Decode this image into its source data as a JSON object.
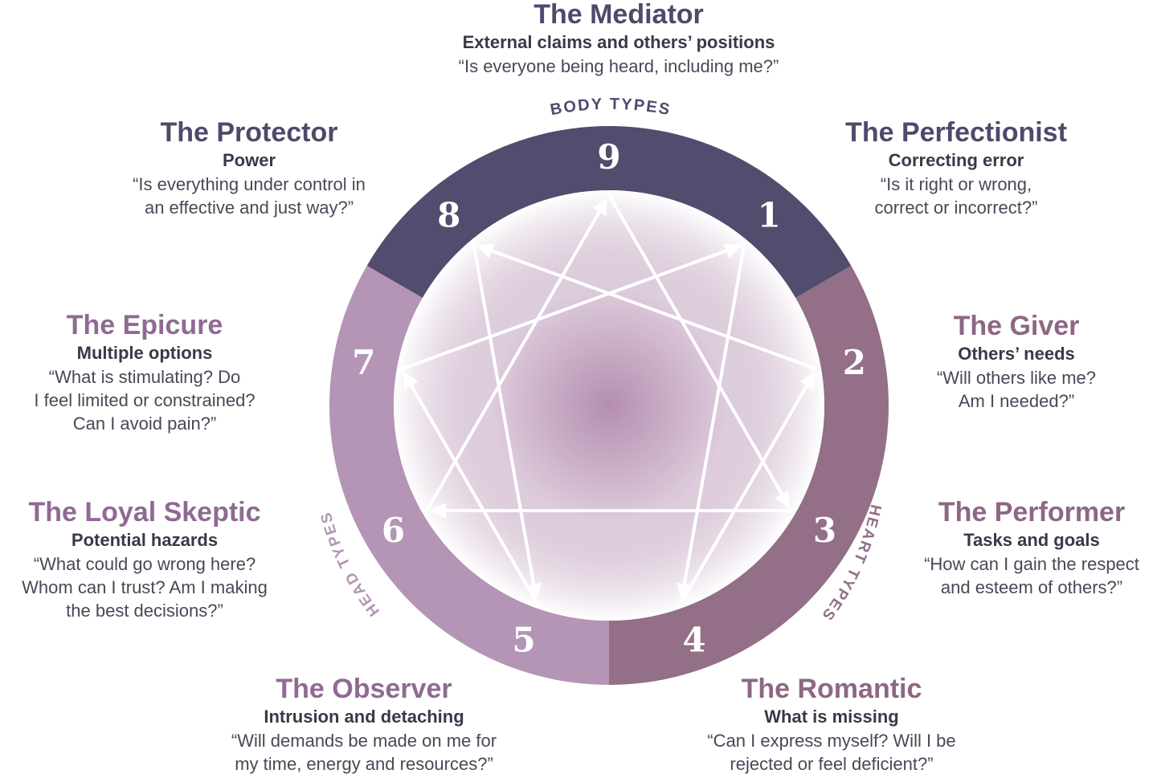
{
  "colors": {
    "body_ring": "#524d6e",
    "heart_ring": "#936f88",
    "head_ring": "#b495b5",
    "center_glow": "#b48eb0",
    "lines": "#ffffff"
  },
  "center": {
    "label": ""
  },
  "groups": {
    "body": "BODY TYPES",
    "heart": "HEART TYPES",
    "head": "HEAD TYPES"
  },
  "points": [
    {
      "number": "9"
    },
    {
      "number": "1"
    },
    {
      "number": "2"
    },
    {
      "number": "3"
    },
    {
      "number": "4"
    },
    {
      "number": "5"
    },
    {
      "number": "6"
    },
    {
      "number": "7"
    },
    {
      "number": "8"
    }
  ],
  "connections": {
    "triangle": [
      "9",
      "3",
      "6"
    ],
    "hexad": [
      "1",
      "4",
      "2",
      "8",
      "5",
      "7"
    ]
  },
  "types": {
    "mediator": {
      "name": "The Mediator",
      "focus": "External claims and others’ positions",
      "question": [
        "“Is everyone being heard, including me?”"
      ]
    },
    "perfectionist": {
      "name": "The Perfectionist",
      "focus": "Correcting error",
      "question": [
        "“Is it right or wrong,",
        "correct or incorrect?”"
      ]
    },
    "giver": {
      "name": "The Giver",
      "focus": "Others’ needs",
      "question": [
        "“Will others like me?",
        "Am I needed?”"
      ]
    },
    "performer": {
      "name": "The Performer",
      "focus": "Tasks and goals",
      "question": [
        "“How can I gain the respect",
        "and esteem of others?”"
      ]
    },
    "romantic": {
      "name": "The Romantic",
      "focus": "What is missing",
      "question": [
        "“Can I express myself? Will I be",
        "rejected or feel deficient?”"
      ]
    },
    "observer": {
      "name": "The Observer",
      "focus": "Intrusion and detaching",
      "question": [
        "“Will demands be made on me for",
        "my time, energy and resources?”"
      ]
    },
    "loyal_skeptic": {
      "name": "The Loyal Skeptic",
      "focus": "Potential hazards",
      "question": [
        "“What could go wrong here?",
        "Whom can I trust? Am I making",
        "the best decisions?”"
      ]
    },
    "epicure": {
      "name": "The Epicure",
      "focus": "Multiple options",
      "question": [
        "“What is stimulating? Do",
        "I feel limited or constrained?",
        "Can I avoid pain?”"
      ]
    },
    "protector": {
      "name": "The Protector",
      "focus": "Power",
      "question": [
        "“Is everything under control in",
        "an effective and just way?”"
      ]
    }
  }
}
